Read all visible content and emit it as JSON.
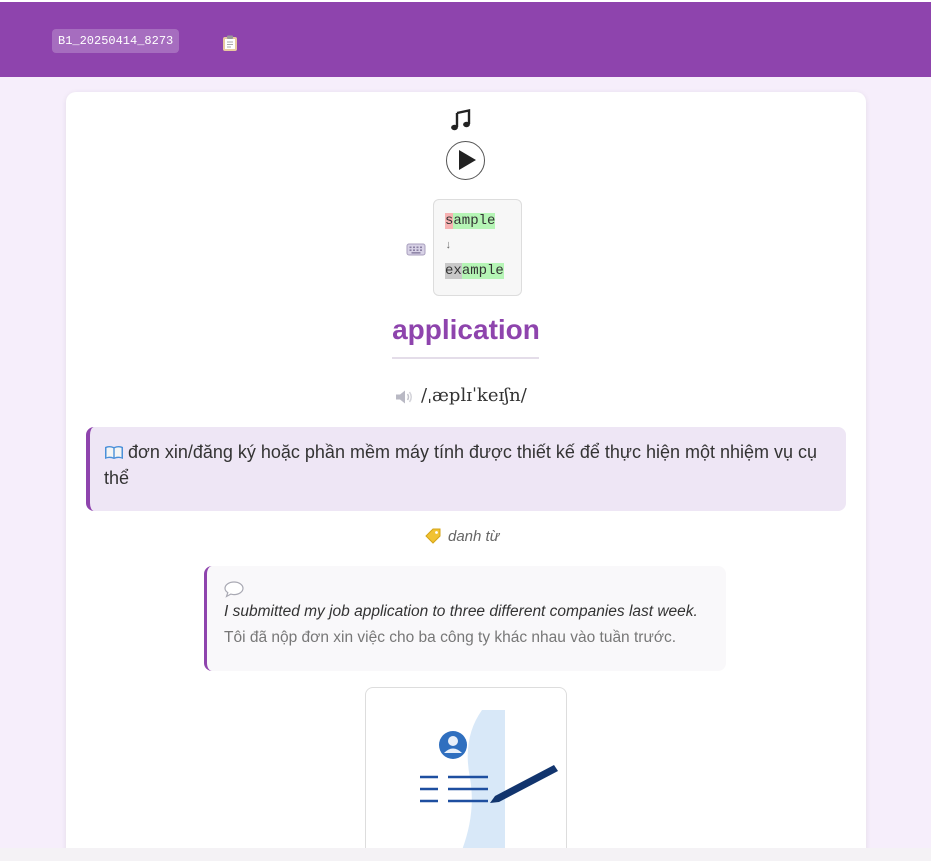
{
  "header": {
    "deck_id": "B1_20250414_8273",
    "clipboard_icon": "clipboard-icon"
  },
  "card": {
    "music_icon": "music-note-icon",
    "play_icon": "play-icon",
    "keyboard_icon": "keyboard-icon",
    "spelling_diff": {
      "from_removed": "s",
      "from_kept": "ample",
      "arrow": "↓",
      "to_changed": "ex",
      "to_kept": "ample"
    },
    "word": "application",
    "speaker_icon": "speaker-icon",
    "ipa": "/ˌæplɪˈkeɪʃn/",
    "definition_icon": "open-book-icon",
    "definition": "đơn xin/đăng ký hoặc phần mềm máy tính được thiết kế để thực hiện một nhiệm vụ cụ thể",
    "pos_icon": "label-tag-icon",
    "part_of_speech": "danh từ",
    "example_icon": "speech-bubble-icon",
    "example_en": "I submitted my job application to three different companies last week.",
    "example_vi": "Tôi đã nộp đơn xin việc cho ba công ty khác nhau vào tuần trước.",
    "illustration": "job-application-form-illustration"
  },
  "colors": {
    "accent": "#8e44ad",
    "page_bg": "#f6eefb",
    "definition_bg": "#eee6f5",
    "diff_removed": "#f7b2b2",
    "diff_added": "#b5f5b5"
  }
}
